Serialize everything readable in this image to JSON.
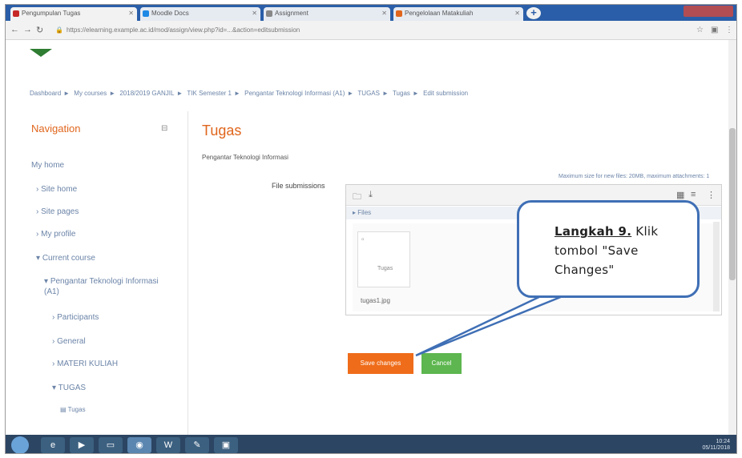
{
  "browser": {
    "tabs": [
      {
        "label": "Pengumpulan Tugas",
        "fav_color": "#c62828"
      },
      {
        "label": "Moodle Docs",
        "fav_color": "#1e88e5"
      },
      {
        "label": "Assignment",
        "fav_color": "#888888"
      },
      {
        "label": "Pengelolaan Matakuliah",
        "fav_color": "#e0661d"
      }
    ],
    "url": "https://elearning.example.ac.id/mod/assign/view.php?id=...&action=editsubmission"
  },
  "breadcrumb": [
    "Dashboard",
    "My courses",
    "2018/2019 GANJIL",
    "TIK Semester 1",
    "Pengantar Teknologi Informasi (A1)",
    "TUGAS",
    "Tugas",
    "Edit submission"
  ],
  "navigation": {
    "title": "Navigation",
    "items": [
      "My home",
      "Site home",
      "Site pages",
      "My profile",
      "Current course",
      "Pengantar Teknologi Informasi (A1)",
      "Participants",
      "General",
      "MATERI KULIAH",
      "TUGAS",
      "Tugas"
    ]
  },
  "content": {
    "title": "Tugas",
    "subtitle": "Pengantar Teknologi Informasi",
    "field_label": "File submissions",
    "max_note": "Maximum size for new files: 20MB, maximum attachments: 1",
    "path": "Files",
    "file_alt": "Tugas",
    "file_name": "tugas1.jpg",
    "save_label": "Save changes",
    "cancel_label": "Cancel"
  },
  "callout": {
    "step": "Langkah 9.",
    "text": " Klik tombol \"Save Changes\""
  },
  "taskbar": {
    "time": "10:24",
    "date": "05/11/2018"
  },
  "colors": {
    "accent": "#e0661d",
    "save": "#ef6c1a",
    "cancel": "#5db64f",
    "callout_border": "#3f6fb5"
  }
}
